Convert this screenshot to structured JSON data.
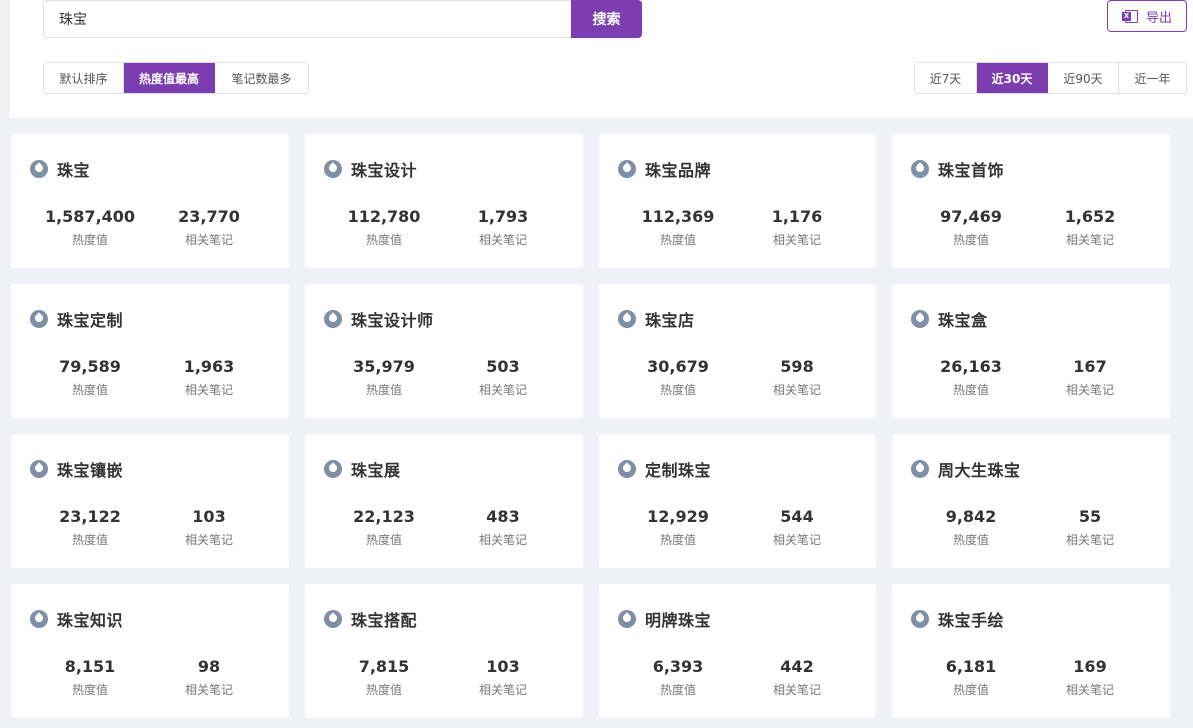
{
  "search": {
    "value": "珠宝",
    "button_label": "搜索"
  },
  "export": {
    "label": "导出",
    "icon": "excel-icon"
  },
  "sort_options": [
    {
      "label": "默认排序",
      "active": false
    },
    {
      "label": "热度值最高",
      "active": true
    },
    {
      "label": "笔记数最多",
      "active": false
    }
  ],
  "time_options": [
    {
      "label": "近7天",
      "active": false
    },
    {
      "label": "近30天",
      "active": true
    },
    {
      "label": "近90天",
      "active": false
    },
    {
      "label": "近一年",
      "active": false
    }
  ],
  "metric_labels": {
    "heat": "热度值",
    "notes": "相关笔记"
  },
  "colors": {
    "accent": "#7b3db0",
    "icon": "#7f8fa6"
  },
  "keywords": [
    {
      "title": "珠宝",
      "heat": "1,587,400",
      "notes": "23,770"
    },
    {
      "title": "珠宝设计",
      "heat": "112,780",
      "notes": "1,793"
    },
    {
      "title": "珠宝品牌",
      "heat": "112,369",
      "notes": "1,176"
    },
    {
      "title": "珠宝首饰",
      "heat": "97,469",
      "notes": "1,652"
    },
    {
      "title": "珠宝定制",
      "heat": "79,589",
      "notes": "1,963"
    },
    {
      "title": "珠宝设计师",
      "heat": "35,979",
      "notes": "503"
    },
    {
      "title": "珠宝店",
      "heat": "30,679",
      "notes": "598"
    },
    {
      "title": "珠宝盒",
      "heat": "26,163",
      "notes": "167"
    },
    {
      "title": "珠宝镶嵌",
      "heat": "23,122",
      "notes": "103"
    },
    {
      "title": "珠宝展",
      "heat": "22,123",
      "notes": "483"
    },
    {
      "title": "定制珠宝",
      "heat": "12,929",
      "notes": "544"
    },
    {
      "title": "周大生珠宝",
      "heat": "9,842",
      "notes": "55"
    },
    {
      "title": "珠宝知识",
      "heat": "8,151",
      "notes": "98"
    },
    {
      "title": "珠宝搭配",
      "heat": "7,815",
      "notes": "103"
    },
    {
      "title": "明牌珠宝",
      "heat": "6,393",
      "notes": "442"
    },
    {
      "title": "珠宝手绘",
      "heat": "6,181",
      "notes": "169"
    }
  ]
}
